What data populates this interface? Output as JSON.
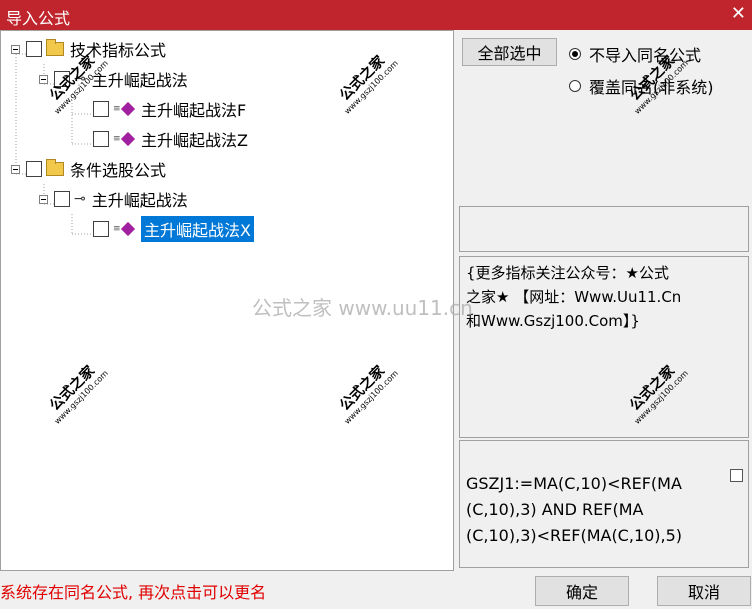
{
  "window": {
    "title": "导入公式",
    "close": "✕"
  },
  "tree": {
    "groups": [
      {
        "label": "技术指标公式",
        "children": [
          {
            "label": "主升崛起战法",
            "formulas": [
              "主升崛起战法F",
              "主升崛起战法Z"
            ]
          }
        ]
      },
      {
        "label": "条件选股公式",
        "children": [
          {
            "label": "主升崛起战法",
            "formulas": [
              "主升崛起战法X"
            ]
          }
        ]
      }
    ],
    "selected": "主升崛起战法X"
  },
  "options": {
    "select_all": "全部选中",
    "radio_no_import": "不导入同名公式",
    "radio_overwrite": "覆盖同名(非系统)",
    "selected_radio": "radio_no_import"
  },
  "description": {
    "line1": "{更多指标关注公众号：★公式",
    "line2": "之家★ 【网址：Www.Uu11.Cn",
    "line3": "和Www.Gszj100.Com】}"
  },
  "formula": {
    "line1": "GSZJ1:=MA(C,10)<REF(MA",
    "line2": "(C,10),3) AND REF(MA",
    "line3": "(C,10),3)<REF(MA(C,10),5)"
  },
  "status": "系统存在同名公式, 再次点击可以更名",
  "buttons": {
    "ok": "确定",
    "cancel": "取消"
  },
  "watermark": {
    "center": "公式之家 www.uu11.cn",
    "stamp_title": "公式之家",
    "stamp_url": "www.gszj100.com"
  },
  "colors": {
    "titlebar": "#c0252d",
    "selection": "#0078d7",
    "status": "#e00000"
  }
}
